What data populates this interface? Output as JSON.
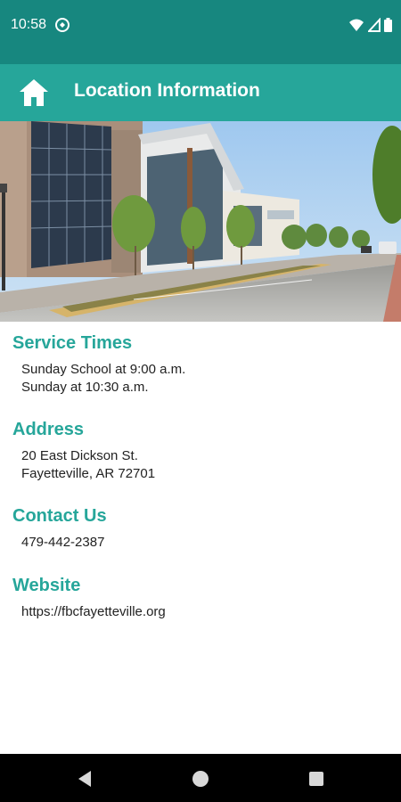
{
  "status_bar": {
    "time": "10:58",
    "icons": [
      "data-saver-icon",
      "wifi-icon",
      "signal-icon",
      "battery-icon"
    ]
  },
  "app_bar": {
    "title": "Location Information",
    "home_icon": "home-icon"
  },
  "sections": {
    "service_times": {
      "heading": "Service Times",
      "lines": [
        "Sunday School at 9:00 a.m.",
        "Sunday at 10:30 a.m."
      ]
    },
    "address": {
      "heading": "Address",
      "lines": [
        "20 East Dickson St.",
        "Fayetteville, AR 72701"
      ]
    },
    "contact": {
      "heading": "Contact Us",
      "lines": [
        "479-442-2387"
      ]
    },
    "website": {
      "heading": "Website",
      "lines": [
        "https://fbcfayetteville.org"
      ]
    }
  },
  "nav_bar": {
    "icons": [
      "back-icon",
      "home-circle-icon",
      "recents-icon"
    ]
  },
  "colors": {
    "status_bar": "#17877f",
    "app_bar": "#26a69a",
    "heading": "#26a69a",
    "nav_bar": "#000000"
  }
}
